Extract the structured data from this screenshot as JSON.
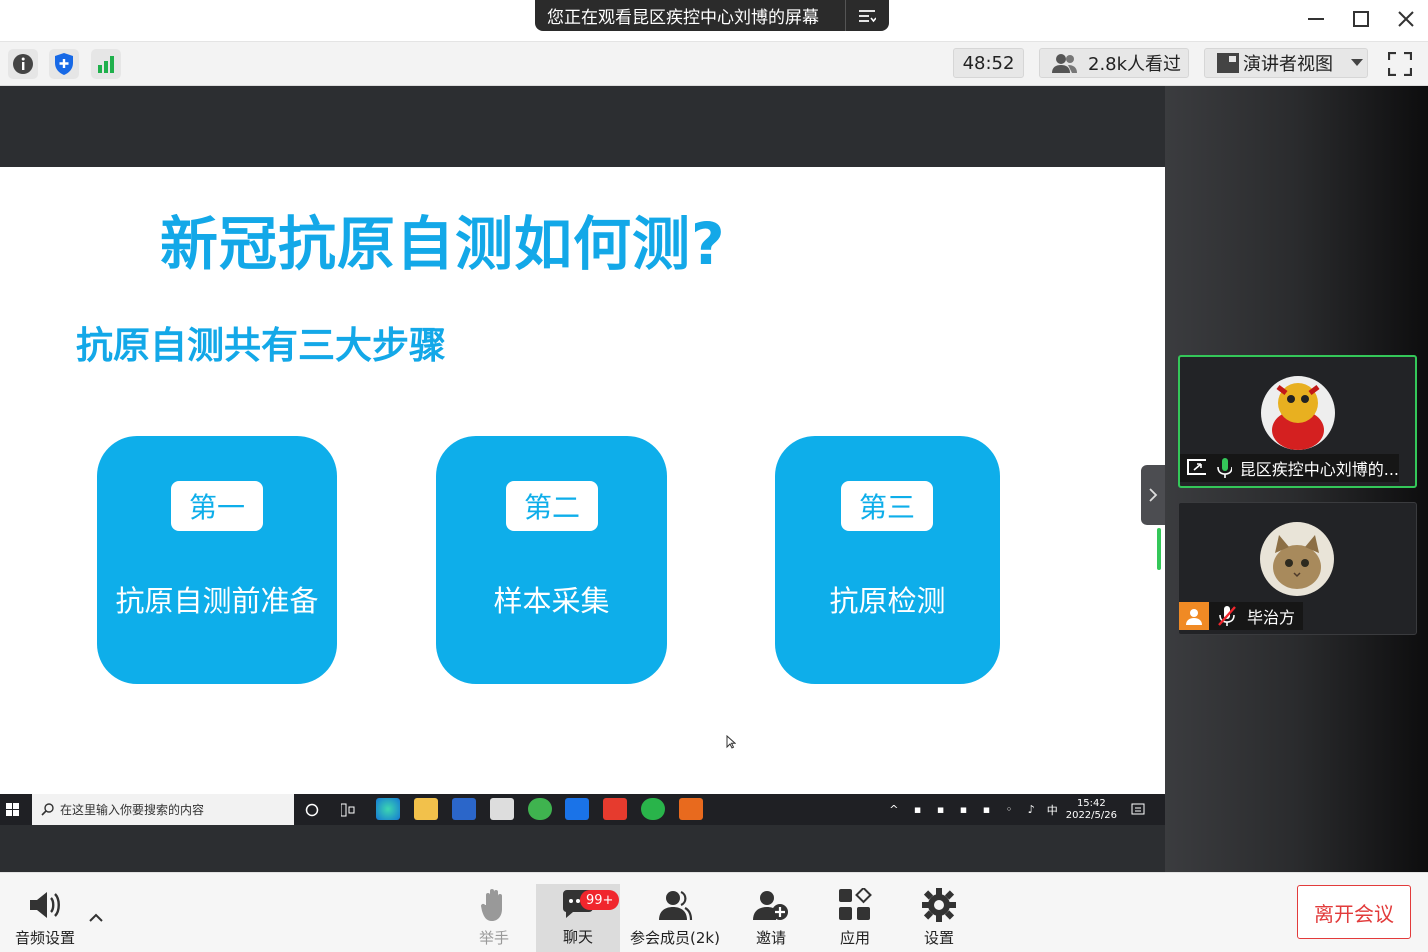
{
  "window": {
    "share_banner": "您正在观看昆区疾控中心刘博的屏幕",
    "minimize_icon": "minimize-icon",
    "maximize_icon": "maximize-icon",
    "close_icon": "close-icon"
  },
  "toolbar": {
    "timer": "48:52",
    "viewers": "2.8k人看过",
    "view_mode": "演讲者视图"
  },
  "slide": {
    "title": "新冠抗原自测如何测?",
    "subtitle": "抗原自测共有三大步骤",
    "steps": [
      {
        "tag": "第一",
        "label": "抗原自测前准备"
      },
      {
        "tag": "第二",
        "label": "样本采集"
      },
      {
        "tag": "第三",
        "label": "抗原检测"
      }
    ]
  },
  "taskbar": {
    "search_placeholder": "在这里输入你要搜索的内容",
    "ime": "中",
    "time": "15:42",
    "date": "2022/5/26"
  },
  "participants": [
    {
      "name": "昆区疾控中心刘博的...",
      "active": true
    },
    {
      "name": "毕治方",
      "active": false
    }
  ],
  "bottombar": {
    "audio": "音频设置",
    "raise_hand": "举手",
    "chat": "聊天",
    "chat_badge": "99+",
    "members": "参会成员(2k)",
    "invite": "邀请",
    "apps": "应用",
    "settings": "设置",
    "leave": "离开会议"
  },
  "colors": {
    "accent_blue": "#13a8e8",
    "card_blue": "#0eaeea",
    "leave_red": "#e23b3b",
    "active_green": "#34c759"
  }
}
